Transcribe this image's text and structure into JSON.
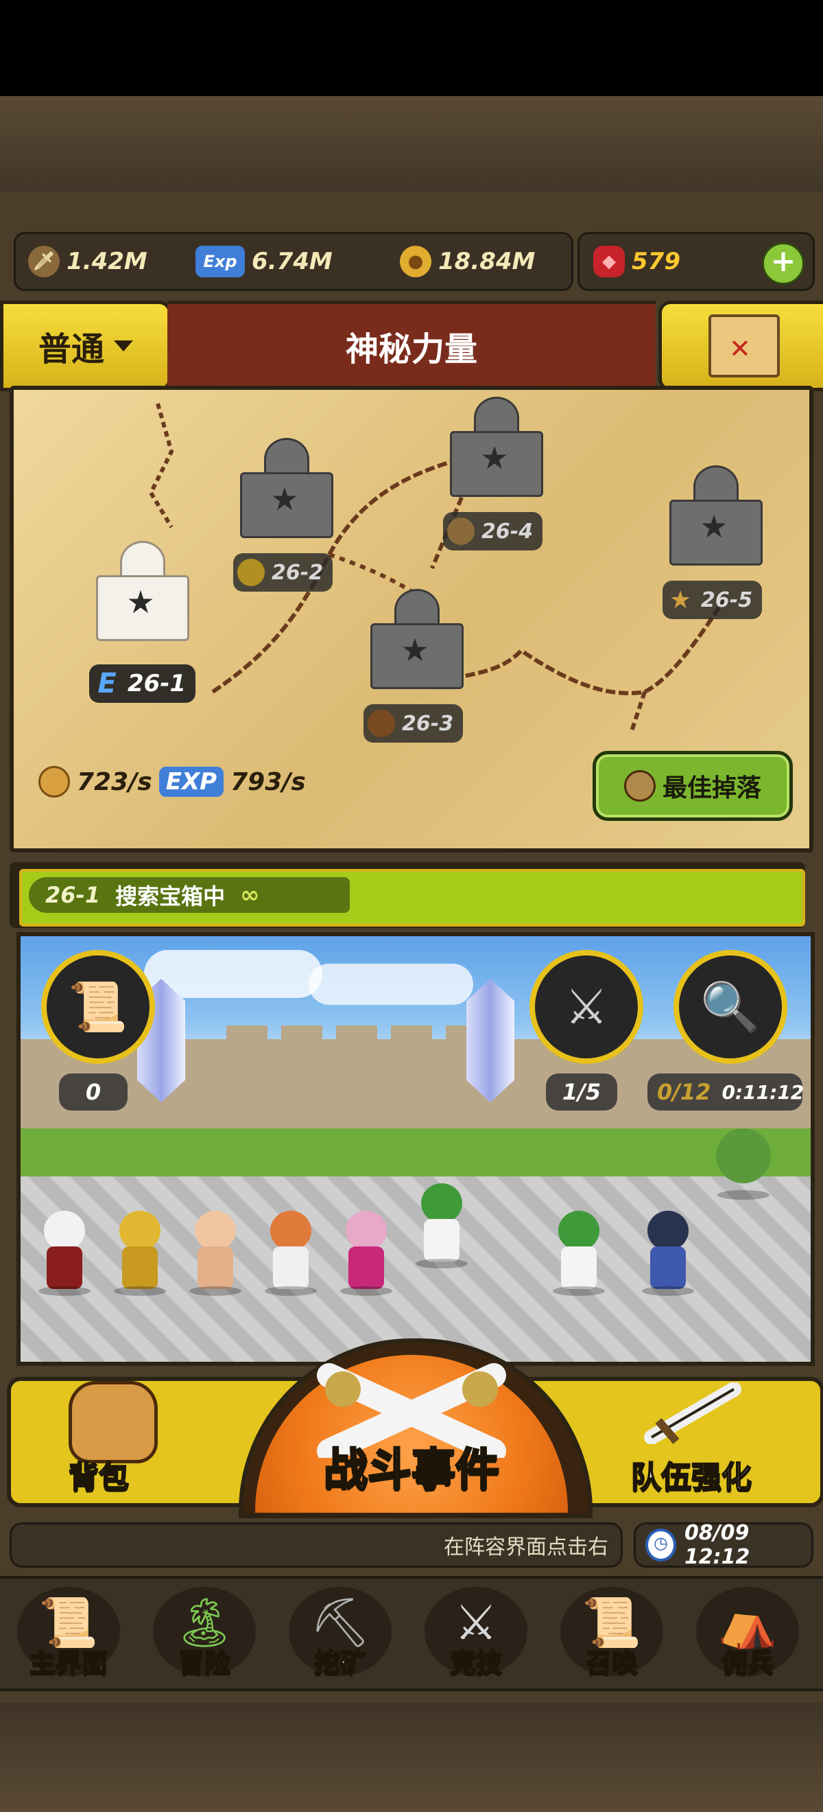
{
  "resources": {
    "attack": "1.42M",
    "exp_label": "Exp",
    "exp": "6.74M",
    "gold": "18.84M",
    "gems": "579"
  },
  "header": {
    "mode": "普通",
    "title": "神秘力量"
  },
  "stage_map": {
    "stages": [
      {
        "id": "26-1",
        "current": true,
        "badge": "E"
      },
      {
        "id": "26-2",
        "current": false
      },
      {
        "id": "26-3",
        "current": false
      },
      {
        "id": "26-4",
        "current": false
      },
      {
        "id": "26-5",
        "current": false
      }
    ],
    "gold_rate": "723/s",
    "exp_badge": "EXP",
    "exp_rate": "793/s",
    "best_drop_label": "最佳掉落"
  },
  "progress": {
    "stage": "26-1",
    "status": "搜索宝箱中",
    "infinity": "∞"
  },
  "battle": {
    "scroll_count": "0",
    "sword_count": "1/5",
    "search_count": "0/12",
    "search_timer": "0:11:12"
  },
  "actions": {
    "bag_label": "背包",
    "battle_label": "战斗事件",
    "upgrade_label": "队伍强化"
  },
  "status_line": {
    "message": "在阵容界面点击右",
    "datetime": "08/09 12:12"
  },
  "nav": [
    {
      "label": "主界面",
      "icon": "scroll-map-icon"
    },
    {
      "label": "冒险",
      "icon": "island-icon"
    },
    {
      "label": "挖矿",
      "icon": "pickaxe-icon"
    },
    {
      "label": "竞技",
      "icon": "crossed-swords-icon"
    },
    {
      "label": "召唤",
      "icon": "summon-scroll-icon"
    },
    {
      "label": "佣兵",
      "icon": "tent-icon"
    }
  ],
  "colors": {
    "accent_yellow": "#e3c51e",
    "title_red": "#7a2c1c",
    "progress_green": "#a6cc1a",
    "battle_orange": "#f07a1a"
  }
}
